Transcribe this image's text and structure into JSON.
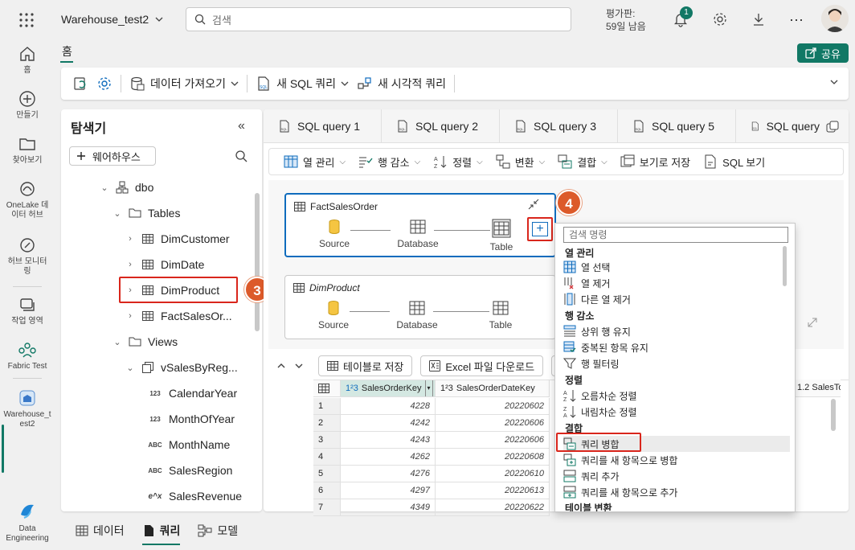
{
  "topbar": {
    "workspace_title": "Warehouse_test2",
    "search_placeholder": "검색",
    "trial_label": "평가판:",
    "trial_days": "59일 남음",
    "notification_count": "1"
  },
  "rail": {
    "items": [
      {
        "label": "홈"
      },
      {
        "label": "만들기"
      },
      {
        "label": "찾아보기"
      },
      {
        "label": "OneLake 데이터 허브"
      },
      {
        "label": "허브 모니터링"
      },
      {
        "label": "작업 영역"
      },
      {
        "label": "Fabric Test"
      },
      {
        "label": "Warehouse_test2"
      },
      {
        "label": "Data Engineering"
      }
    ]
  },
  "home_tab": "홈",
  "share_label": "공유",
  "ribbon": {
    "get_data": "데이터 가져오기",
    "new_sql_query": "새 SQL 쿼리",
    "new_visual_query": "새 시각적 쿼리"
  },
  "explorer": {
    "title": "탐색기",
    "warehouse_btn": "웨어하우스",
    "tree": [
      {
        "label": "dbo"
      },
      {
        "label": "Tables"
      },
      {
        "label": "DimCustomer"
      },
      {
        "label": "DimDate"
      },
      {
        "label": "DimProduct"
      },
      {
        "label": "FactSalesOr..."
      },
      {
        "label": "Views"
      },
      {
        "label": "vSalesByReg..."
      },
      {
        "label": "CalendarYear",
        "type": "123"
      },
      {
        "label": "MonthOfYear",
        "type": "123"
      },
      {
        "label": "MonthName",
        "type": "ABC"
      },
      {
        "label": "SalesRegion",
        "type": "ABC"
      },
      {
        "label": "SalesRevenue",
        "type": "e^x"
      }
    ]
  },
  "callouts": {
    "step3": "3",
    "step4": "4"
  },
  "tabs": [
    "SQL query 1",
    "SQL query 2",
    "SQL query 3",
    "SQL query 5",
    "SQL query"
  ],
  "toolbar2": {
    "manage_columns": "열 관리",
    "reduce_rows": "행 감소",
    "sort": "정렬",
    "transform": "변환",
    "combine": "결합",
    "save_as_view": "보기로 저장",
    "view_sql": "SQL 보기"
  },
  "diagram": {
    "cards": [
      {
        "title": "FactSalesOrder",
        "steps": [
          "Source",
          "Database",
          "Table"
        ]
      },
      {
        "title": "DimProduct",
        "steps": [
          "Source",
          "Database",
          "Table"
        ]
      }
    ],
    "add_step": "+"
  },
  "results": {
    "save_as_table": "테이블로 저장",
    "download_excel": "Excel 파일 다운로드",
    "columns": [
      "SalesOrderKey",
      "SalesOrderDateKey",
      "SalesTo"
    ],
    "col_types": [
      "1²3",
      "1²3",
      "1.2"
    ],
    "rows": [
      {
        "idx": "1",
        "key": "4228",
        "date": "20220602"
      },
      {
        "idx": "2",
        "key": "4242",
        "date": "20220606"
      },
      {
        "idx": "3",
        "key": "4243",
        "date": "20220606"
      },
      {
        "idx": "4",
        "key": "4262",
        "date": "20220608"
      },
      {
        "idx": "5",
        "key": "4276",
        "date": "20220610"
      },
      {
        "idx": "6",
        "key": "4297",
        "date": "20220613"
      },
      {
        "idx": "7",
        "key": "4349",
        "date": "20220622"
      }
    ]
  },
  "context_menu": {
    "search_placeholder": "검색 명령",
    "sections": [
      {
        "title": "열 관리",
        "items": [
          "열 선택",
          "열 제거",
          "다른 열 제거"
        ]
      },
      {
        "title": "행 감소",
        "items": [
          "상위 행 유지",
          "중복된 항목 유지",
          "행 필터링"
        ]
      },
      {
        "title": "정렬",
        "items": [
          "오름차순 정렬",
          "내림차순 정렬"
        ]
      },
      {
        "title": "결합",
        "items": [
          "쿼리 병합",
          "쿼리를 새 항목으로 병합",
          "쿼리 추가",
          "쿼리를 새 항목으로 추가"
        ]
      },
      {
        "title": "테이블 변환",
        "items": []
      }
    ]
  },
  "bottom_tabs": [
    "데이터",
    "쿼리",
    "모델"
  ],
  "colors": {
    "accent": "#117865",
    "selection_blue": "#0f6cbd",
    "callout_red": "#d9261c",
    "callout_orange": "#dc5a2a"
  }
}
